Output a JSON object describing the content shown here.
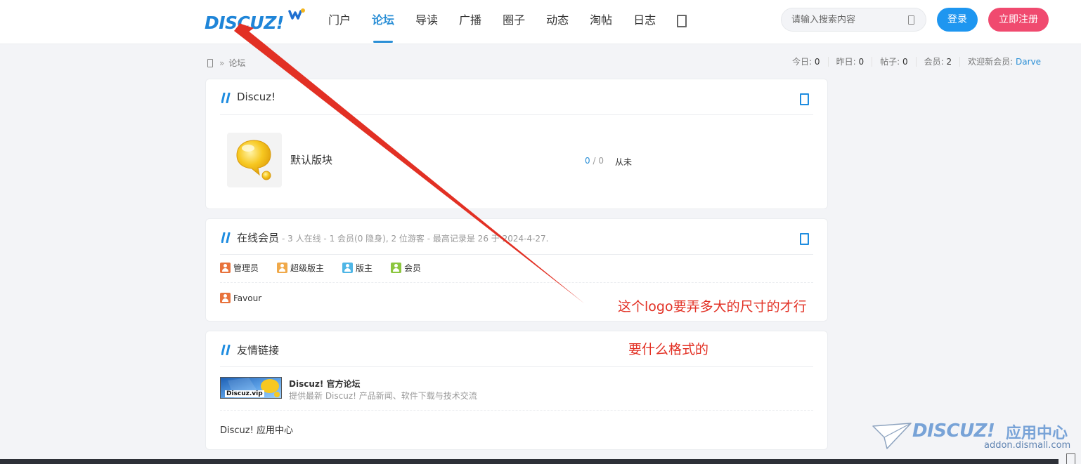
{
  "header": {
    "logo_text": "DISCUZ!",
    "nav": [
      {
        "label": "门户"
      },
      {
        "label": "论坛",
        "active": true
      },
      {
        "label": "导读"
      },
      {
        "label": "广播"
      },
      {
        "label": "圈子"
      },
      {
        "label": "动态"
      },
      {
        "label": "淘帖"
      },
      {
        "label": "日志"
      }
    ],
    "search_placeholder": "请输入搜索内容",
    "login_label": "登录",
    "register_label": "立即注册"
  },
  "breadcrumb": {
    "separator": "»",
    "current": "论坛"
  },
  "stats": {
    "today_label": "今日:",
    "today_value": "0",
    "yesterday_label": "昨日:",
    "yesterday_value": "0",
    "posts_label": "帖子:",
    "posts_value": "0",
    "members_label": "会员:",
    "members_value": "2",
    "welcome_label": "欢迎新会员:",
    "welcome_user": "Darve"
  },
  "forum_group": {
    "title": "Discuz!",
    "forums": [
      {
        "name": "默认版块",
        "threads": "0",
        "slash": " / ",
        "posts": "0",
        "last_post": "从未"
      }
    ]
  },
  "online": {
    "title": "在线会员",
    "summary": "- 3 人在线 - 1 会员(0 隐身), 2 位游客 - 最高记录是 26 于 2024-4-27.",
    "legend": [
      {
        "label": "管理员",
        "color": "#e8733c"
      },
      {
        "label": "超级版主",
        "color": "#f0a94a"
      },
      {
        "label": "版主",
        "color": "#4fb6e6"
      },
      {
        "label": "会员",
        "color": "#8cc63f"
      }
    ],
    "users": [
      {
        "name": "Favour",
        "color": "#e8733c"
      }
    ]
  },
  "links": {
    "title": "友情链接",
    "items": [
      {
        "banner_text": "Discuz.vip",
        "title": "Discuz! 官方论坛",
        "desc": "提供最新 Discuz! 产品新闻、软件下载与技术交流"
      }
    ],
    "plain_link": "Discuz! 应用中心"
  },
  "annotations": {
    "line1": "这个logo要弄多大的尺寸的才行",
    "line2": "要什么格式的",
    "color": "#e23024"
  },
  "watermark": {
    "brand": "DISCUZ!",
    "cn": "应用中心",
    "url": "addon.dismall.com"
  },
  "colors": {
    "accent": "#2b8fd6",
    "login": "#1e96f0",
    "register": "#f04a6f"
  }
}
